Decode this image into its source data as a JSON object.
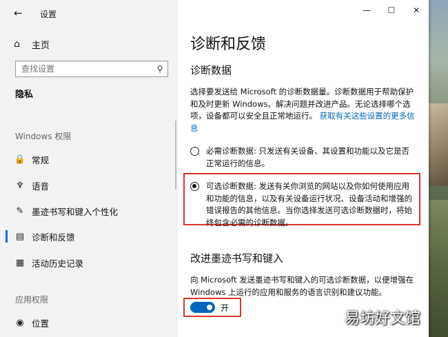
{
  "window": {
    "title": "设置"
  },
  "sidebar": {
    "home_label": "主页",
    "search_placeholder": "查找设置",
    "section": "隐私",
    "group_windows": "Windows 权限",
    "items": [
      {
        "label": "常规",
        "icon": "lock-icon"
      },
      {
        "label": "语音",
        "icon": "speech-icon"
      },
      {
        "label": "墨迹书写和键入个性化",
        "icon": "ink-icon"
      },
      {
        "label": "诊断和反馈",
        "icon": "diagnostics-icon",
        "active": true
      },
      {
        "label": "活动历史记录",
        "icon": "history-icon"
      }
    ],
    "group_app": "应用权限",
    "app_items": [
      {
        "label": "位置",
        "icon": "location-icon"
      }
    ]
  },
  "content": {
    "title": "诊断和反馈",
    "section1": "诊断数据",
    "intro": "选择要发送给 Microsoft 的诊断数据量。诊断数据用于帮助保护和及时更新 Windows、解决问题并改进产品。无论选择哪个选项，设备都可以安全且正常地运行。",
    "intro_link": "获取有关这些设置的更多信息",
    "option_required": "必需诊断数据: 只发送有关设备、其设置和功能以及它是否正常运行的信息。",
    "option_optional": "可选诊断数据: 发送有关你浏览的网站以及你如何使用应用和功能的信息，以及有关设备运行状况、设备活动和增强的错误报告的其他信息。当你选择发送可选诊断数据时，将始终包含必需的诊断数据。",
    "selected_option": "optional",
    "section2": "改进墨迹书写和键入",
    "ink_desc": "向 Microsoft 发送墨迹书写和键入的可选诊断数据，以便增强在 Windows 上运行的应用和服务的语言识别和建议功能。",
    "toggle_label": "开",
    "toggle_on": true
  },
  "watermark": "易坊好文馆",
  "colors": {
    "accent": "#0067c0",
    "highlight": "#d9342b",
    "sidebar_bg": "#f2f2f2"
  }
}
